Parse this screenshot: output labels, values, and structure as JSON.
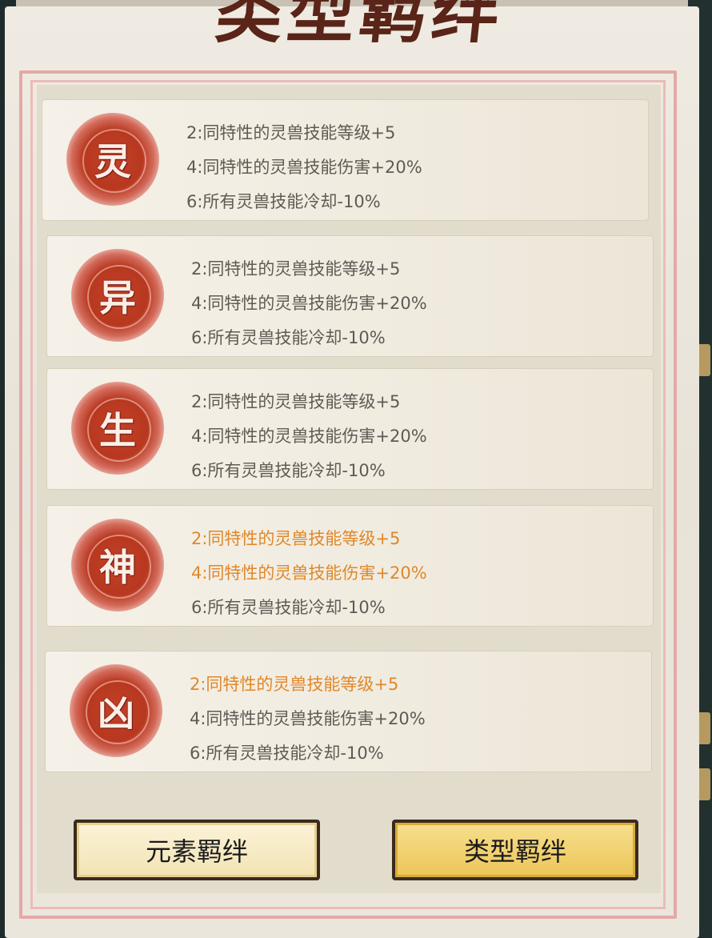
{
  "title": "类型羁绊",
  "bonds": [
    {
      "seal_char": "灵",
      "lines": [
        {
          "text": "2:同特性的灵兽技能等级+5",
          "active": false
        },
        {
          "text": "4:同特性的灵兽技能伤害+20%",
          "active": false
        },
        {
          "text": "6:所有灵兽技能冷却-10%",
          "active": false
        }
      ]
    },
    {
      "seal_char": "异",
      "lines": [
        {
          "text": "2:同特性的灵兽技能等级+5",
          "active": false
        },
        {
          "text": "4:同特性的灵兽技能伤害+20%",
          "active": false
        },
        {
          "text": "6:所有灵兽技能冷却-10%",
          "active": false
        }
      ]
    },
    {
      "seal_char": "生",
      "lines": [
        {
          "text": "2:同特性的灵兽技能等级+5",
          "active": false
        },
        {
          "text": "4:同特性的灵兽技能伤害+20%",
          "active": false
        },
        {
          "text": "6:所有灵兽技能冷却-10%",
          "active": false
        }
      ]
    },
    {
      "seal_char": "神",
      "lines": [
        {
          "text": "2:同特性的灵兽技能等级+5",
          "active": true
        },
        {
          "text": "4:同特性的灵兽技能伤害+20%",
          "active": true
        },
        {
          "text": "6:所有灵兽技能冷却-10%",
          "active": false
        }
      ]
    },
    {
      "seal_char": "凶",
      "lines": [
        {
          "text": "2:同特性的灵兽技能等级+5",
          "active": true
        },
        {
          "text": "4:同特性的灵兽技能伤害+20%",
          "active": false
        },
        {
          "text": "6:所有灵兽技能冷却-10%",
          "active": false
        }
      ]
    }
  ],
  "buttons": {
    "element_bond": "元素羁绊",
    "type_bond": "类型羁绊",
    "selected": "type_bond"
  },
  "colors": {
    "active_text": "#e0872a",
    "inactive_text": "#5f5a55",
    "seal_red": "#b8371f",
    "title": "#5a2418"
  }
}
